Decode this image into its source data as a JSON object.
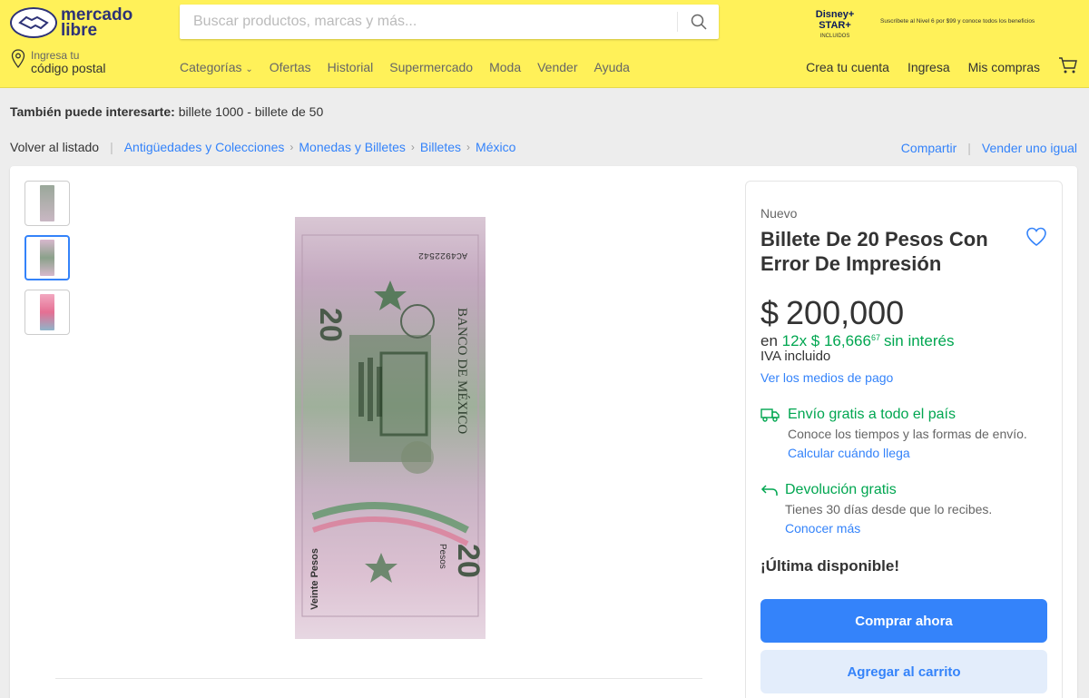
{
  "header": {
    "logo_line1": "mercado",
    "logo_line2": "libre",
    "search_placeholder": "Buscar productos, marcas y más...",
    "promo_logo": "Disney+ STAR+",
    "promo_included": "INCLUIDOS",
    "promo_text": "Suscríbete al Nivel 6 por $99 y conoce todos los beneficios",
    "location_small": "Ingresa tu",
    "location_big": "código postal",
    "nav": [
      "Categorías",
      "Ofertas",
      "Historial",
      "Supermercado",
      "Moda",
      "Vender",
      "Ayuda"
    ],
    "nav_right": {
      "create_account": "Crea tu cuenta",
      "login": "Ingresa",
      "purchases": "Mis compras"
    }
  },
  "interest": {
    "label": "También puede interesarte:",
    "items": "billete 1000 - billete de 50"
  },
  "breadcrumb": {
    "back": "Volver al listado",
    "items": [
      "Antigüedades y Colecciones",
      "Monedas y Billetes",
      "Billetes",
      "México"
    ],
    "share": "Compartir",
    "sell": "Vender uno igual"
  },
  "product": {
    "condition": "Nuevo",
    "title": "Billete De 20 Pesos Con Error De Impresión",
    "currency": "$",
    "price": "200,000",
    "installments_prefix": "en",
    "installments_main": "12x $ 16,666",
    "installments_cents": "67",
    "installments_suffix": "sin interés",
    "iva": "IVA incluido",
    "payment_methods": "Ver los medios de pago",
    "shipping_title": "Envío gratis a todo el país",
    "shipping_desc": "Conoce los tiempos y las formas de envío.",
    "shipping_link": "Calcular cuándo llega",
    "return_title": "Devolución gratis",
    "return_desc": "Tienes 30 días desde que lo recibes.",
    "return_link": "Conocer más",
    "stock": "¡Última disponible!",
    "buy_now": "Comprar ahora",
    "add_to_cart": "Agregar al carrito"
  },
  "banknote": {
    "serial": "AC4922542",
    "denomination": "20",
    "bank": "BANCO DE MÉXICO",
    "words": "Veinte Pesos",
    "pesos": "Pesos"
  },
  "colors": {
    "header_bg": "#fff159",
    "accent": "#3483fa",
    "green": "#00a650"
  }
}
